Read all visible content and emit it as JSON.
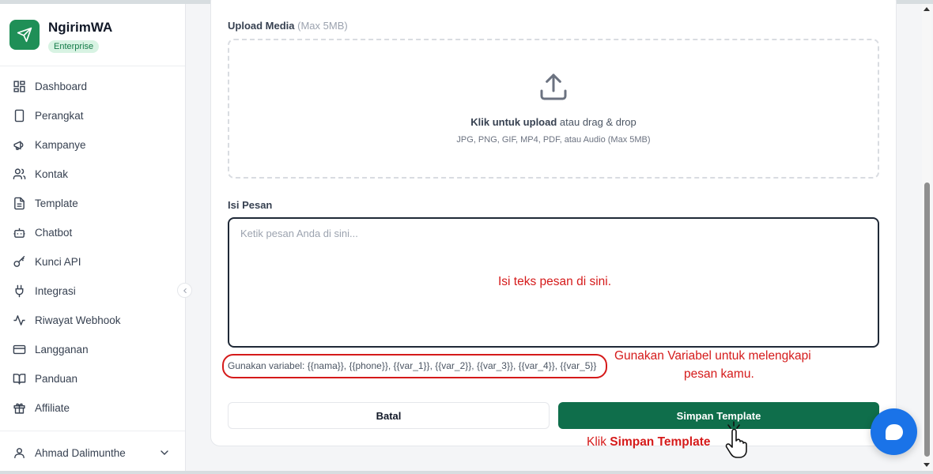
{
  "sidebar": {
    "brand": {
      "name": "NgirimWA",
      "badge": "Enterprise",
      "logo_icon": "send-icon",
      "accent": "#1f8f57"
    },
    "items": [
      {
        "label": "Dashboard",
        "icon": "dashboard-icon"
      },
      {
        "label": "Perangkat",
        "icon": "device-icon"
      },
      {
        "label": "Kampanye",
        "icon": "megaphone-icon"
      },
      {
        "label": "Kontak",
        "icon": "users-icon"
      },
      {
        "label": "Template",
        "icon": "document-icon"
      },
      {
        "label": "Chatbot",
        "icon": "bot-icon"
      },
      {
        "label": "Kunci API",
        "icon": "key-icon"
      },
      {
        "label": "Integrasi",
        "icon": "plug-icon"
      },
      {
        "label": "Riwayat Webhook",
        "icon": "activity-icon"
      },
      {
        "label": "Langganan",
        "icon": "credit-card-icon"
      },
      {
        "label": "Panduan",
        "icon": "book-icon"
      },
      {
        "label": "Affiliate",
        "icon": "gift-icon"
      }
    ],
    "user": {
      "name": "Ahmad Dalimunthe"
    }
  },
  "form": {
    "upload": {
      "label": "Upload Media",
      "limit": "(Max 5MB)",
      "cta_bold": "Klik untuk upload",
      "cta_rest": " atau drag & drop",
      "formats": "JPG, PNG, GIF, MP4, PDF, atau Audio (Max 5MB)"
    },
    "message": {
      "label": "Isi Pesan",
      "placeholder": "Ketik pesan Anda di sini...",
      "variables_hint": "Gunakan variabel: {{nama}}, {{phone}}, {{var_1}}, {{var_2}}, {{var_3}}, {{var_4}}, {{var_5}}"
    },
    "buttons": {
      "cancel": "Batal",
      "save": "Simpan Template"
    }
  },
  "annotations": {
    "textarea_note": "Isi teks pesan di sini.",
    "variables_note_line1": "Gunakan Variabel untuk melengkapi",
    "variables_note_line2": "pesan kamu.",
    "save_note_prefix": "Klik ",
    "save_note_bold": "Simpan Template",
    "color": "#d51a1a"
  },
  "colors": {
    "primary": "#0f6e4b",
    "chat_fab": "#1a73e8"
  }
}
